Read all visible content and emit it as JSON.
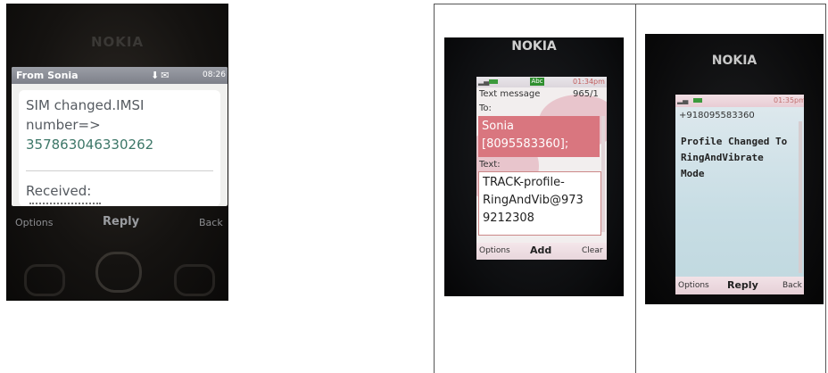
{
  "photo1": {
    "brand": "NOKIA",
    "header": {
      "sender": "From Sonia",
      "time": "08:26"
    },
    "message": {
      "line1": "SIM changed.IMSI",
      "line2": "number=>",
      "number": "357863046330262",
      "received": "Received:"
    },
    "softkeys": {
      "left": "Options",
      "center": "Reply",
      "right": "Back"
    }
  },
  "photo2": {
    "brand": "NOKIA",
    "status": {
      "time": "01:34pm",
      "input_mode": "Abc"
    },
    "title": "Text message",
    "counter": "965/1",
    "to_label": "To:",
    "to_name": "Sonia",
    "to_number": "[8095583360];",
    "text_label": "Text:",
    "text_lines": [
      "TRACK-profile-",
      "RingAndVib@973",
      "9212308"
    ],
    "softkeys": {
      "left": "Options",
      "center": "Add",
      "right": "Clear"
    }
  },
  "photo3": {
    "brand": "NOKIA",
    "status": {
      "time": "01:35pm"
    },
    "sender_number": "+918095583360",
    "message_lines": [
      "Profile Changed To",
      "RingAndVibrate",
      "Mode"
    ],
    "softkeys": {
      "left": "Options",
      "center": "Reply",
      "right": "Back"
    }
  }
}
